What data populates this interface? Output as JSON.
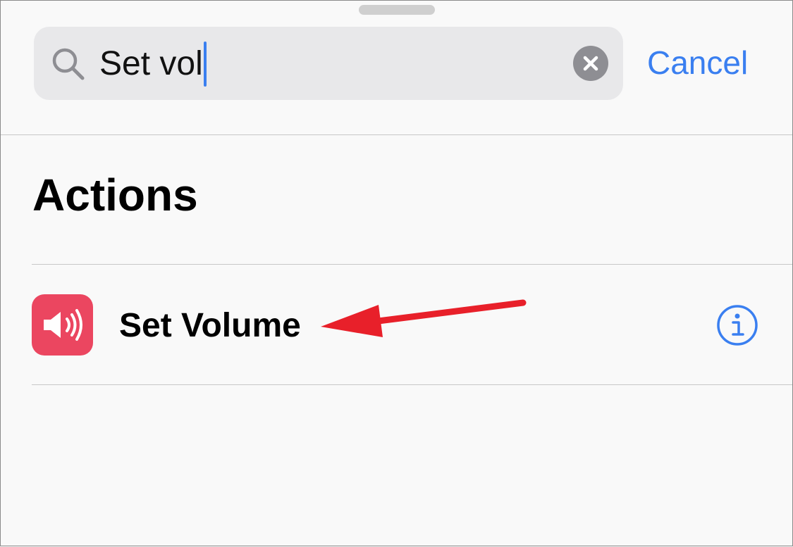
{
  "search": {
    "query": "Set vol",
    "cancel_label": "Cancel",
    "icon": "magnifying-glass-icon",
    "clear_icon": "clear-circle-icon"
  },
  "section": {
    "title": "Actions"
  },
  "results": [
    {
      "label": "Set Volume",
      "icon": "speaker-volume-icon",
      "icon_color": "#eb4660",
      "info_icon": "info-circle-icon"
    }
  ],
  "colors": {
    "accent": "#3a7ff0",
    "annotation_arrow": "#e8202a"
  }
}
